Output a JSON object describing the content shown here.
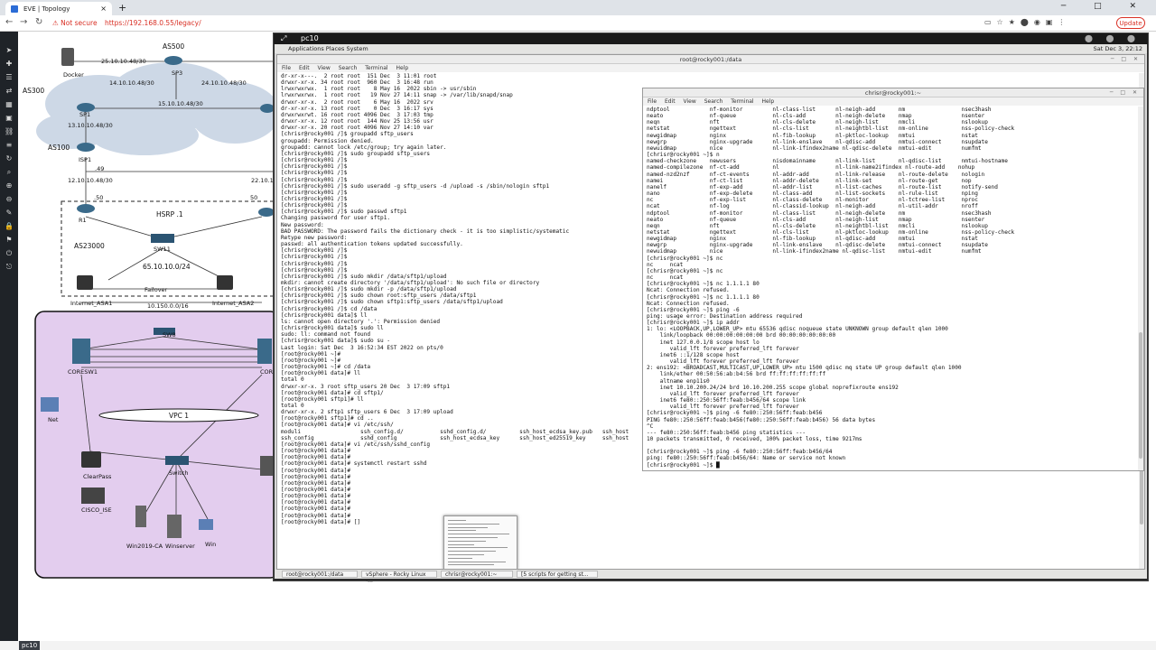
{
  "browser": {
    "tab_title": "EVE | Topology",
    "tab_close": "×",
    "new_tab": "+",
    "window_controls": "─ □ ✕",
    "nav_back": "←",
    "nav_forward": "→",
    "nav_reload": "↻",
    "security_label": "⚠ Not secure",
    "url": "https://192.168.0.55/legacy/",
    "update_label": "Update"
  },
  "eve_toolbar": {
    "icons": [
      "arrow-icon",
      "plus-icon",
      "menu-icon",
      "arrows-icon",
      "chart-icon",
      "image-icon",
      "link-icon",
      "list-icon",
      "refresh-icon",
      "search-icon",
      "zoom-in-icon",
      "zoom-out-icon",
      "edit-icon",
      "lock-icon",
      "tag-icon",
      "power-icon",
      "exit-icon"
    ]
  },
  "topology": {
    "labels": [
      {
        "text": "AS500",
        "cls": "topo-big"
      },
      {
        "text": "Docker"
      },
      {
        "text": "25.10.10.48/30"
      },
      {
        "text": "SP3"
      },
      {
        "text": "AS300",
        "cls": "topo-big"
      },
      {
        "text": "14.10.10.48/30"
      },
      {
        "text": "24.10.10.48/30"
      },
      {
        "text": "SP1"
      },
      {
        "text": "15.10.10.48/30"
      },
      {
        "text": "13.10.10.48/30"
      },
      {
        "text": "AS100",
        "cls": "topo-big"
      },
      {
        "text": "ISP1"
      },
      {
        "text": ".49"
      },
      {
        "text": "12.10.10.48/30"
      },
      {
        "text": "22.10.10"
      },
      {
        "text": ".50"
      },
      {
        "text": "50"
      },
      {
        "text": "HSRP .1",
        "cls": "topo-big"
      },
      {
        "text": "R1"
      },
      {
        "text": "SW11"
      },
      {
        "text": "AS23000",
        "cls": "topo-big"
      },
      {
        "text": "65.10.10.0/24",
        "cls": "topo-big"
      },
      {
        "text": "Internet_ASA1"
      },
      {
        "text": "Failover"
      },
      {
        "text": "Internet_ASA2"
      },
      {
        "text": "10.150.0.0/16"
      },
      {
        "text": "SW8"
      },
      {
        "text": "CORESW1"
      },
      {
        "text": "COR"
      },
      {
        "text": "Net"
      },
      {
        "text": "VPC 1",
        "cls": "topo-big"
      },
      {
        "text": "ClearPass"
      },
      {
        "text": "Switch"
      },
      {
        "text": "CISCO_ISE"
      },
      {
        "text": "Win2019-CA"
      },
      {
        "text": "Winserver"
      },
      {
        "text": "Win"
      }
    ],
    "task_chip": "pc10"
  },
  "vnc": {
    "title": "pc10",
    "expand_icon": "⤢",
    "controls": "⬤ ⬤ ⬤",
    "panel_menus": "Applications   Places   System",
    "panel_clock": "Sat Dec 3, 22:12"
  },
  "term1": {
    "title": "root@rocky001:/data",
    "menu": [
      "File",
      "Edit",
      "View",
      "Search",
      "Terminal",
      "Help"
    ],
    "buttons": "─ □ ✕",
    "lines": "dr-xr-x---.  2 root root  151 Dec  3 11:01 root\ndrwxr-xr-x. 34 root root  960 Dec  3 16:48 run\nlrwxrwxrwx.  1 root root    8 May 16  2022 sbin -> usr/sbin\nlrwxrwxrwx.  1 root root   19 Nov 27 14:11 snap -> /var/lib/snapd/snap\ndrwxr-xr-x.  2 root root    6 May 16  2022 srv\ndr-xr-xr-x. 13 root root    0 Dec  3 16:17 sys\ndrwxrwxrwt. 16 root root 4096 Dec  3 17:03 tmp\ndrwxr-xr-x. 12 root root  144 Nov 25 13:56 usr\ndrwxr-xr-x. 20 root root 4096 Nov 27 14:10 var\n[chrisr@rocky001 /]$ groupadd sftp_users\ngroupadd: Permission denied.\ngroupadd: cannot lock /etc/group; try again later.\n[chrisr@rocky001 /]$ sudo groupadd sftp_users\n[chrisr@rocky001 /]$\n[chrisr@rocky001 /]$\n[chrisr@rocky001 /]$\n[chrisr@rocky001 /]$\n[chrisr@rocky001 /]$ sudo useradd -g sftp_users -d /upload -s /sbin/nologin sftp1\n[chrisr@rocky001 /]$\n[chrisr@rocky001 /]$\n[chrisr@rocky001 /]$\n[chrisr@rocky001 /]$ sudo passwd sftp1\nChanging password for user sftp1.\nNew password:\nBAD PASSWORD: The password fails the dictionary check - it is too simplistic/systematic\nRetype new password:\npasswd: all authentication tokens updated successfully.\n[chrisr@rocky001 /]$\n[chrisr@rocky001 /]$\n[chrisr@rocky001 /]$\n[chrisr@rocky001 /]$\n[chrisr@rocky001 /]$ sudo mkdir /data/sftp1/upload\nmkdir: cannot create directory '/data/sftp1/upload': No such file or directory\n[chrisr@rocky001 /]$ sudo mkdir -p /data/sftp1/upload\n[chrisr@rocky001 /]$ sudo chown root:sftp_users /data/sftp1\n[chrisr@rocky001 /]$ sudo chown sftp1:sftp_users /data/sftp1/upload\n[chrisr@rocky001 /]$ cd /data\n[chrisr@rocky001 data]$ ll\nls: cannot open directory '.': Permission denied\n[chrisr@rocky001 data]$ sudo ll\nsudo: ll: command not found\n[chrisr@rocky001 data]$ sudo su -\nLast login: Sat Dec  3 16:52:34 EST 2022 on pts/0\n[root@rocky001 ~]#\n[root@rocky001 ~]#\n[root@rocky001 ~]# cd /data\n[root@rocky001 data]# ll\ntotal 0\ndrwxr-xr-x. 3 root sftp_users 20 Dec  3 17:09 sftp1\n[root@rocky001 data]# cd sftp1/\n[root@rocky001 sftp1]# ll\ntotal 0\ndrwxr-xr-x. 2 sftp1 sftp_users 6 Dec  3 17:09 upload\n[root@rocky001 sftp1]# cd ..\n[root@rocky001 data]# vi /etc/ssh/\nmoduli                  ssh_config.d/           sshd_config.d/          ssh_host_ecdsa_key.pub   ssh_host\nssh_config              sshd_config             ssh_host_ecdsa_key      ssh_host_ed25519_key     ssh_host\n[root@rocky001 data]# vi /etc/ssh/sshd_config\n[root@rocky001 data]#\n[root@rocky001 data]#\n[root@rocky001 data]# systemctl restart sshd\n[root@rocky001 data]#\n[root@rocky001 data]#\n[root@rocky001 data]#\n[root@rocky001 data]#\n[root@rocky001 data]#\n[root@rocky001 data]#\n[root@rocky001 data]#\n[root@rocky001 data]#\n[root@rocky001 data]# []"
  },
  "term2": {
    "title": "chrisr@rocky001:~",
    "menu": [
      "File",
      "Edit",
      "View",
      "Search",
      "Terminal",
      "Help"
    ],
    "buttons": "─ □ ✕",
    "lines": "ndptool            nf-monitor         nl-class-list      nl-neigh-add       nm                 nsec3hash\nneato              nf-queue           nl-cls-add         nl-neigh-delete    nmap               nsenter\nneqn               nft                nl-cls-delete      nl-neigh-list      nmcli              nslookup\nnetstat            ngettext           nl-cls-list        nl-neightbl-list   nm-online          nss-policy-check\nnewgidmap          nginx              nl-fib-lookup      nl-pktloc-lookup   nmtui              nstat\nnewgrp             nginx-upgrade      nl-link-enslave    nl-qdisc-add       nmtui-connect      nsupdate\nnewuidmap          nice               nl-link-ifindex2name nl-qdisc-delete  nmtui-edit         numfmt\n[chrisr@rocky001 ~]$ n\nnamed-checkzone    newusers           nisdomainname      nl-link-list       nl-qdisc-list      nmtui-hostname\nnamed-compilezone  nf-ct-add          nl                 nl-link-name2ifindex nl-route-add    nohup\nnamed-nzd2nzf      nf-ct-events       nl-addr-add        nl-link-release    nl-route-delete    nologin\nnamei              nf-ct-list         nl-addr-delete     nl-link-set        nl-route-get       nop\nnanelf             nf-exp-add         nl-addr-list       nl-list-caches     nl-route-list      notify-send\nnano               nf-exp-delete      nl-class-add       nl-list-sockets    nl-rule-list       nping\nnc                 nf-exp-list        nl-class-delete    nl-monitor         nl-tctree-list     nproc\nncat               nf-log             nl-classid-lookup  nl-neigh-add       nl-util-addr       nroff\nndptool            nf-monitor         nl-class-list      nl-neigh-delete    nm                 nsec3hash\nneato              nf-queue           nl-cls-add         nl-neigh-list      nmap               nsenter\nneqn               nft                nl-cls-delete      nl-neightbl-list   nmcli              nslookup\nnetstat            ngettext           nl-cls-list        nl-pktloc-lookup   nm-online          nss-policy-check\nnewgidmap          nginx              nl-fib-lookup      nl-qdisc-add       nmtui              nstat\nnewgrp             nginx-upgrade      nl-link-enslave    nl-qdisc-delete    nmtui-connect      nsupdate\nnewuidmap          nice               nl-link-ifindex2name nl-qdisc-list    nmtui-edit         numfmt\n[chrisr@rocky001 ~]$ nc\nnc     ncat\n[chrisr@rocky001 ~]$ nc\nnc     ncat\n[chrisr@rocky001 ~]$ nc 1.1.1.1 80\nNcat: Connection refused.\n[chrisr@rocky001 ~]$ nc 1.1.1.1 80\nNcat: Connection refused.\n[chrisr@rocky001 ~]$ ping -6\nping: usage error: Destination address required\n[chrisr@rocky001 ~]$ ip addr\n1: lo: <LOOPBACK,UP,LOWER_UP> mtu 65536 qdisc noqueue state UNKNOWN group default qlen 1000\n    link/loopback 00:00:00:00:00:00 brd 00:00:00:00:00:00\n    inet 127.0.0.1/8 scope host lo\n       valid_lft forever preferred_lft forever\n    inet6 ::1/128 scope host\n       valid_lft forever preferred_lft forever\n2: ens192: <BROADCAST,MULTICAST,UP,LOWER_UP> mtu 1500 qdisc mq state UP group default qlen 1000\n    link/ether 00:50:56:ab:b4:56 brd ff:ff:ff:ff:ff:ff\n    altname enp11s0\n    inet 10.10.200.24/24 brd 10.10.200.255 scope global noprefixroute ens192\n       valid_lft forever preferred_lft forever\n    inet6 fe80::250:56ff:feab:b456/64 scope link\n       valid_lft forever preferred_lft forever\n[chrisr@rocky001 ~]$ ping -6 fe80::250:56ff:feab:b456\nPING fe80::250:56ff:feab:b456(fe80::250:56ff:feab:b456) 56 data bytes\n^C\n--- fe80::250:56ff:feab:b456 ping statistics ---\n10 packets transmitted, 0 received, 100% packet loss, time 9217ms\n\n[chrisr@rocky001 ~]$ ping -6 fe80::250:56ff:feab:b456/64\nping: fe80::250:56ff:feab:b456/64: Name or service not known\n[chrisr@rocky001 ~]$ █"
  },
  "gnome_tasks": [
    {
      "label": "root@rocky001:/data"
    },
    {
      "label": "vSphere - Rocky Linux -..."
    },
    {
      "label": "chrisr@rocky001:~"
    },
    {
      "label": "[5 scripts for getting st..."
    }
  ]
}
